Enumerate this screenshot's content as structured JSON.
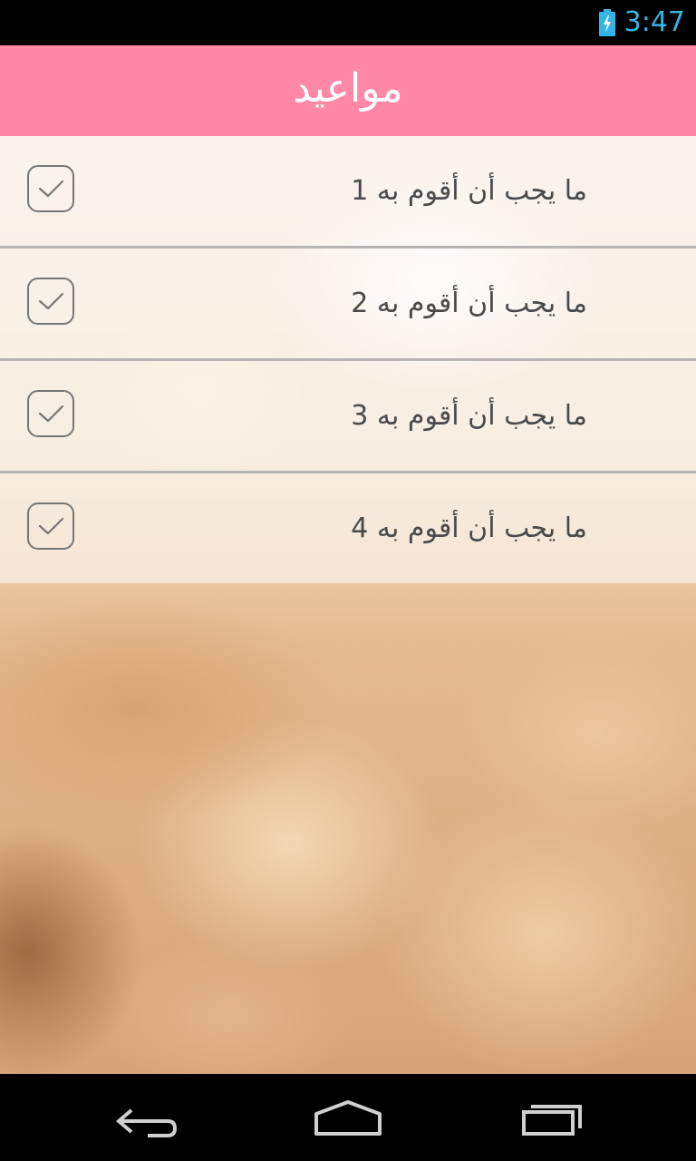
{
  "status_bar": {
    "time": "3:47",
    "battery_icon": "battery-charging-icon",
    "clock_color": "#33b5e5"
  },
  "app_bar": {
    "title": "مواعيد",
    "background_color": "#ff88a6"
  },
  "list": {
    "items": [
      {
        "label": "ما يجب أن أقوم به 1",
        "checked": false
      },
      {
        "label": "ما يجب أن أقوم به 2",
        "checked": false
      },
      {
        "label": "ما يجب أن أقوم به 3",
        "checked": false
      },
      {
        "label": "ما يجب أن أقوم به 4",
        "checked": false
      }
    ]
  },
  "nav_bar": {
    "back_icon": "back-arrow-icon",
    "home_icon": "home-icon",
    "recents_icon": "recent-apps-icon"
  }
}
